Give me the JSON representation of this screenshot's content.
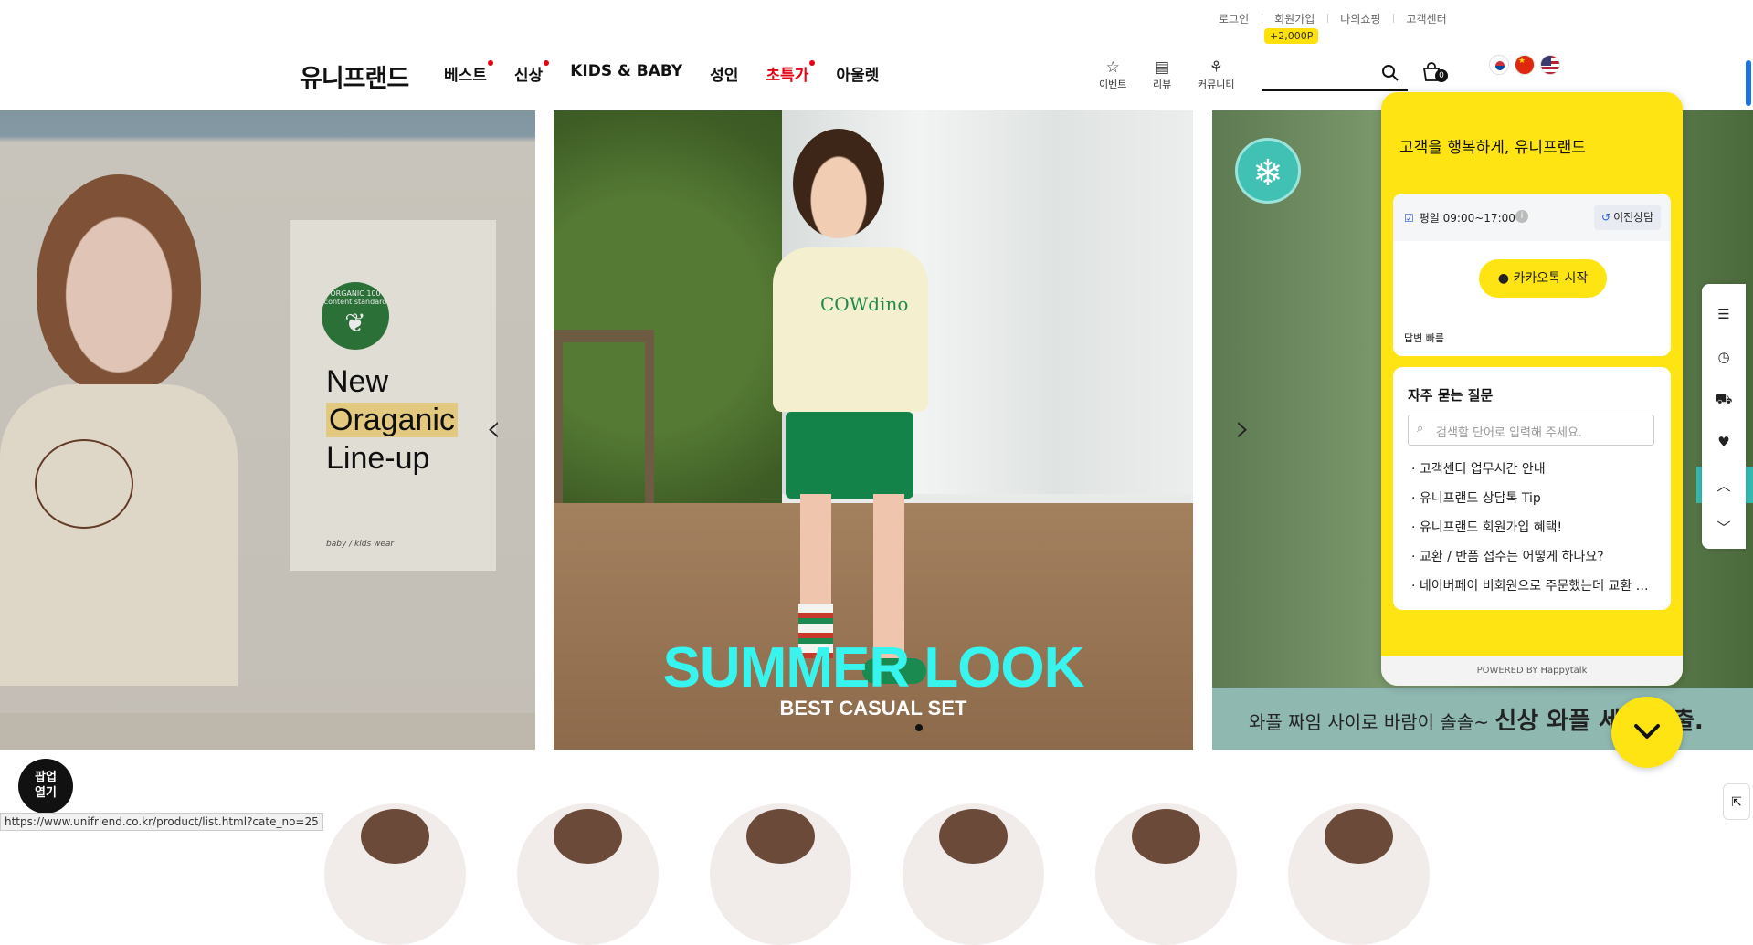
{
  "header": {
    "util_links": [
      "로그인",
      "회원가입",
      "나의쇼핑",
      "고객센터"
    ],
    "point_badge": "+2,000P",
    "logo": "유니프랜드",
    "nav": [
      {
        "label": "베스트",
        "dot": true,
        "red": false
      },
      {
        "label": "신상",
        "dot": true,
        "red": false
      },
      {
        "label": "KIDS & BABY",
        "dot": false,
        "red": false
      },
      {
        "label": "성인",
        "dot": false,
        "red": false
      },
      {
        "label": "초특가",
        "dot": true,
        "red": true
      },
      {
        "label": "아울렛",
        "dot": false,
        "red": false
      }
    ],
    "icon_menu": [
      {
        "icon": "star-icon",
        "label": "이벤트"
      },
      {
        "icon": "review-icon",
        "label": "리뷰"
      },
      {
        "icon": "community-icon",
        "label": "커뮤니티"
      }
    ],
    "search_value": "",
    "cart_count": "0",
    "flags": [
      "korea-flag",
      "china-flag",
      "usa-flag"
    ]
  },
  "banner": {
    "left": {
      "badge_text": "ORGANIC 100 content standard",
      "line1": "New",
      "line2": "Oraganic",
      "line3": "Line-up",
      "small": "baby / kids wear"
    },
    "main": {
      "shirt_print": "COWdino",
      "title": "SUMMER LOOK",
      "subtitle": "BEST CASUAL SET"
    },
    "right": {
      "caption_normal": "와플 짜임 사이로 바람이 솔솔~ ",
      "caption_bold": "신상 와플 세트룩 출."
    }
  },
  "popup_button": {
    "line1": "팝업",
    "line2": "열기"
  },
  "status_url": "https://www.unifriend.co.kr/product/list.html?cate_no=25",
  "chat": {
    "title": "고객을 행복하게, 유니프랜드",
    "hours": "평일 09:00~17:00",
    "prev_button": "이전상담",
    "kakao_button": "카카오톡 시작",
    "fast_reply": "답변 빠름",
    "faq_title": "자주 묻는 질문",
    "faq_search_placeholder": "검색할 단어로 입력해 주세요.",
    "faq_items": [
      "· 고객센터 업무시간 안내",
      "· 유니프랜드 상담톡 Tip",
      "· 유니프랜드 회원가입 혜택!",
      "· 교환 / 반품 접수는 어떻게 하나요?",
      "· 네이버페이 비회원으로 주문했는데 교환 …"
    ],
    "powered_by": "POWERED BY",
    "powered_brand": "Happytalk"
  },
  "colors": {
    "accent_yellow": "#ffe414",
    "nav_red": "#e60012",
    "summer_cyan": "#38f4ee"
  }
}
